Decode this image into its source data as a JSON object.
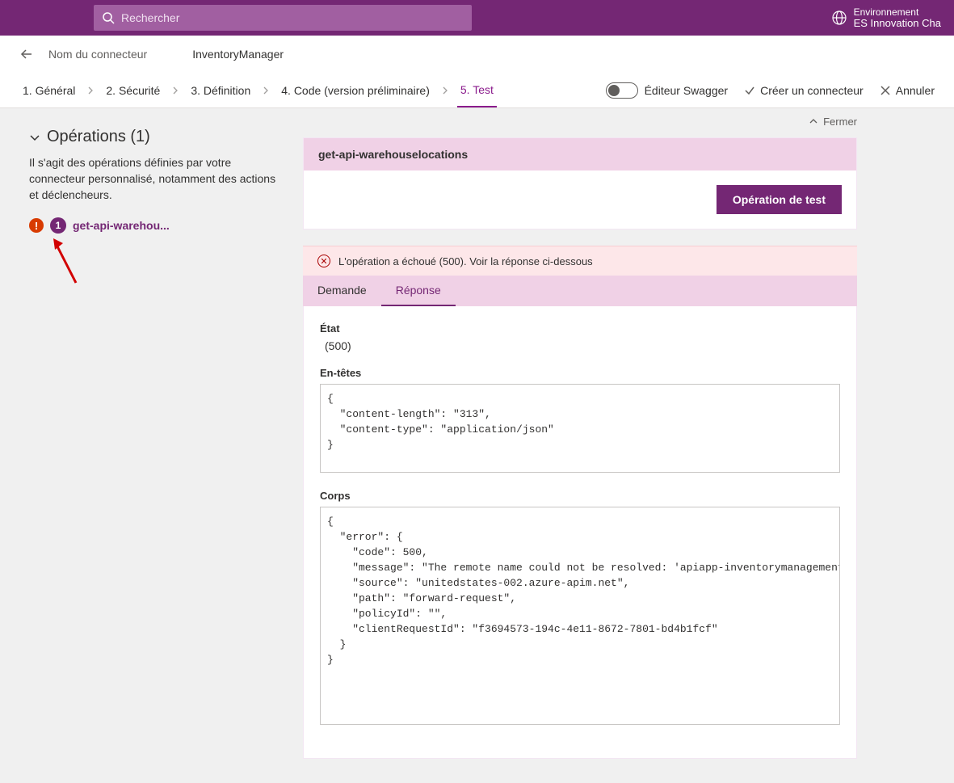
{
  "topbar": {
    "search_placeholder": "Rechercher",
    "env_label": "Environnement",
    "env_name": "ES Innovation Cha"
  },
  "breadcrumb": {
    "label": "Nom du connecteur",
    "value": "InventoryManager"
  },
  "steps": {
    "items": [
      {
        "label": "1. Général"
      },
      {
        "label": "2. Sécurité"
      },
      {
        "label": "3. Définition"
      },
      {
        "label": "4. Code (version préliminaire)"
      },
      {
        "label": "5. Test"
      }
    ],
    "swagger_toggle": "Éditeur Swagger",
    "create_connector": "Créer un connecteur",
    "cancel": "Annuler"
  },
  "sidebar": {
    "ops_title": "Opérations (1)",
    "ops_desc": "Il s'agit des opérations définies par votre connecteur personnalisé, notamment des actions et déclencheurs.",
    "op_err": "!",
    "op_num": "1",
    "op_name": "get-api-warehou..."
  },
  "content": {
    "close_label": "Fermer",
    "op_title": "get-api-warehouselocations",
    "test_button": "Opération de test",
    "error_text": "L'opération a échoué (500). Voir la réponse ci-dessous",
    "tabs": {
      "request": "Demande",
      "response": "Réponse"
    },
    "status_label": "État",
    "status_value": "(500)",
    "headers_label": "En-têtes",
    "headers_content": "{\n  \"content-length\": \"313\",\n  \"content-type\": \"application/json\"\n}",
    "body_label": "Corps",
    "body_content": "{\n  \"error\": {\n    \"code\": 500,\n    \"message\": \"The remote name could not be resolved: 'apiapp-inventorymanagement.azurewebsite\n    \"source\": \"unitedstates-002.azure-apim.net\",\n    \"path\": \"forward-request\",\n    \"policyId\": \"\",\n    \"clientRequestId\": \"f3694573-194c-4e11-8672-7801-bd4b1fcf\"\n  }\n}"
  }
}
